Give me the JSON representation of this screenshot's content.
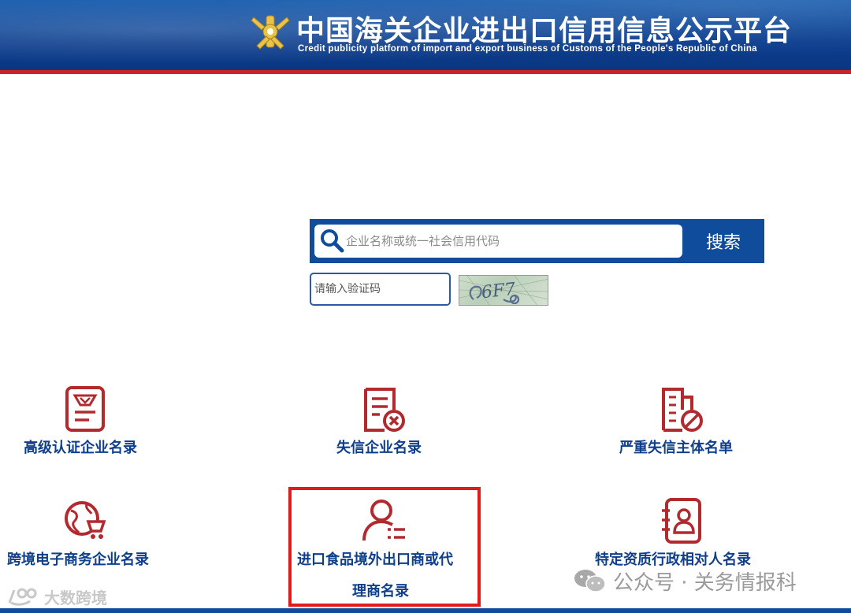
{
  "header": {
    "title": "中国海关企业进出口信用信息公示平台",
    "subtitle": "Credit publicity platform of import and export business of Customs of the People's Republic of China",
    "emblem_icon": "customs-emblem-icon"
  },
  "search": {
    "placeholder": "企业名称或统一社会信用代码",
    "value": "",
    "button_label": "搜索",
    "captcha_placeholder": "请输入验证码",
    "captcha_text": "6F7"
  },
  "categories": [
    {
      "label": "高级认证企业名录",
      "icon": "certified-badge-icon"
    },
    {
      "label": "失信企业名录",
      "icon": "document-cross-icon"
    },
    {
      "label": "严重失信主体名单",
      "icon": "building-prohibited-icon"
    },
    {
      "label": "跨境电子商务企业名录",
      "icon": "globe-cart-icon"
    },
    {
      "label_line1": "进口食品境外出口商或代",
      "label_line2": "理商名录",
      "icon": "person-list-icon"
    },
    {
      "label": "特定资质行政相对人名录",
      "icon": "contact-card-icon"
    }
  ],
  "watermarks": {
    "right": "公众号 · 关务情报科",
    "left": "大数跨境"
  },
  "colors": {
    "header_blue": "#0d3f8f",
    "accent_red": "#c8242b",
    "icon_red": "#b22a2e",
    "label_blue": "#0f3f8a",
    "highlight_red": "#e11a1a"
  }
}
